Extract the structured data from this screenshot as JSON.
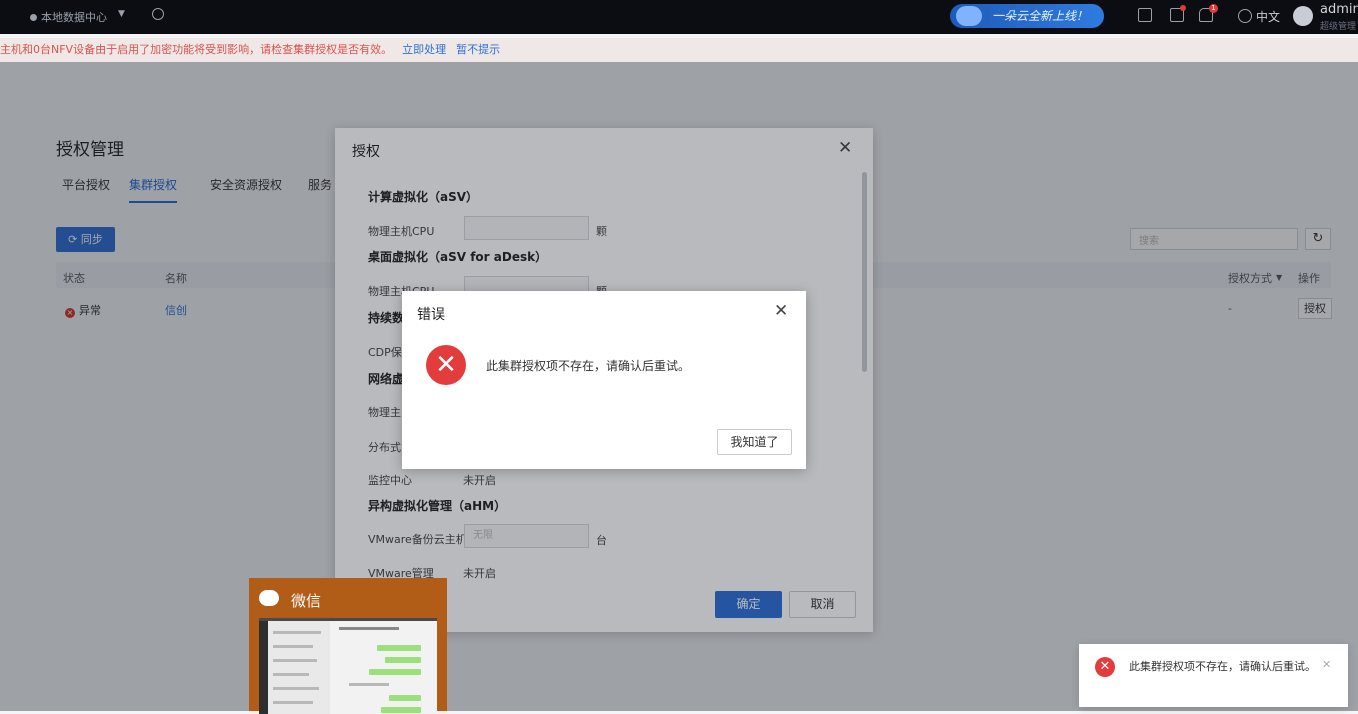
{
  "topbar": {
    "location": "本地数据中心",
    "promo": "一朵云全新上线！",
    "notification_badge": "1",
    "lang": "中文",
    "user": "admin",
    "user_sub": "超级管理"
  },
  "alert": {
    "text": "主机和0台NFV设备由于启用了加密功能将受到影响，请检查集群授权是否有效。",
    "action": "立即处理",
    "dismiss": "暂不提示"
  },
  "page": {
    "title": "授权管理",
    "tabs": [
      "平台授权",
      "集群授权",
      "安全资源授权",
      "服务"
    ],
    "sync": "同步",
    "search_placeholder": "搜索",
    "columns": {
      "status": "状态",
      "name": "名称",
      "auth_mode": "授权方式",
      "ops": "操作"
    },
    "row": {
      "status": "异常",
      "name": "信创",
      "auth_mode": "-",
      "op": "授权"
    }
  },
  "auth_dialog": {
    "title": "授权",
    "sec_asv": "计算虚拟化（aSV）",
    "phys_cpu": "物理主机CPU",
    "unit_ge": "颗",
    "sec_adesk": "桌面虚拟化（aSV for aDesk）",
    "sec_cdp": "持续数",
    "cdp_label": "CDP保",
    "sec_net": "网络虚",
    "net_phys": "物理主",
    "dist": "分布式",
    "monitor": "监控中心",
    "not_enabled": "未开启",
    "sec_ahm": "异构虚拟化管理（aHM）",
    "vmware_backup": "VMware备份云主机",
    "vmware_placeholder": "无限",
    "unit_tai": "台",
    "vmware_mgmt": "VMware管理",
    "confirm": "确定",
    "cancel": "取消"
  },
  "error_dialog": {
    "title": "错误",
    "message": "此集群授权项不存在，请确认后重试。",
    "ok": "我知道了"
  },
  "wechat": {
    "title": "微信"
  },
  "toast": {
    "message": "此集群授权项不存在，请确认后重试。"
  }
}
